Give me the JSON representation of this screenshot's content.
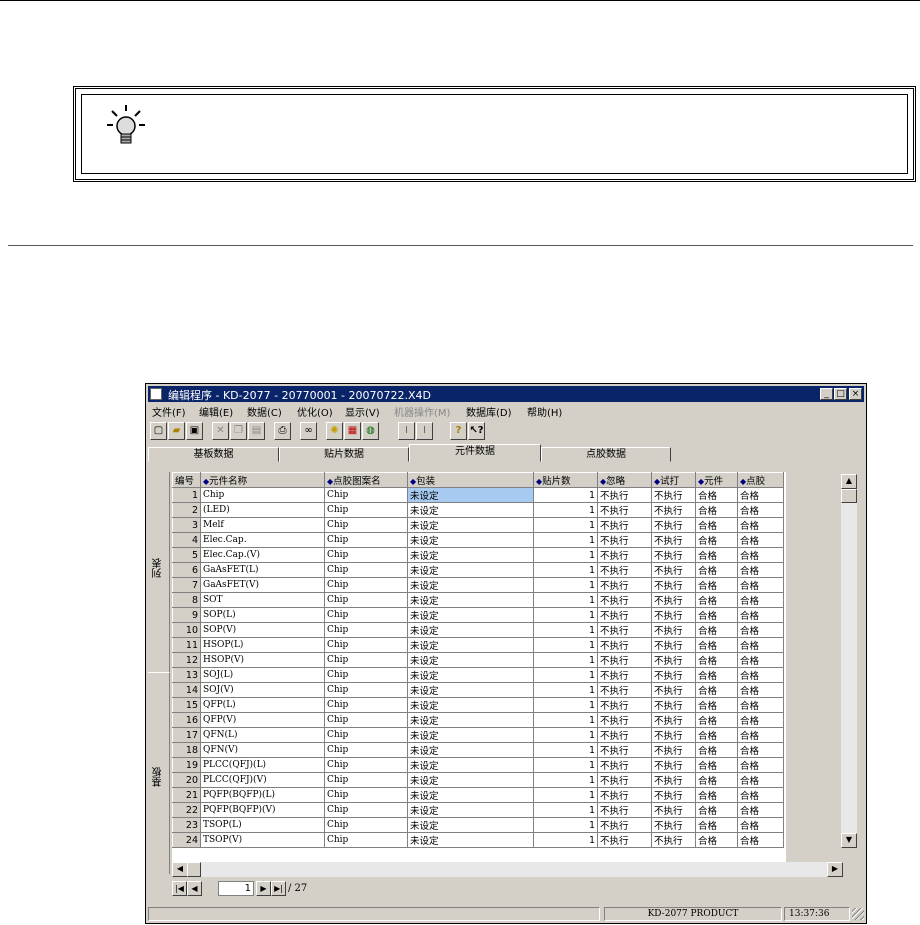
{
  "window": {
    "title": "编辑程序 - KD-2077 - 20770001 - 20070722.X4D"
  },
  "menu": [
    {
      "label": "文件(F)",
      "enabled": true
    },
    {
      "label": "编辑(E)",
      "enabled": true
    },
    {
      "label": "数据(C)",
      "enabled": true
    },
    {
      "label": "优化(O)",
      "enabled": true
    },
    {
      "label": "显示(V)",
      "enabled": true
    },
    {
      "label": "机器操作(M)",
      "enabled": false
    },
    {
      "label": "数据库(D)",
      "enabled": true
    },
    {
      "label": "帮助(H)",
      "enabled": true
    }
  ],
  "tabs": [
    "基板数据",
    "贴片数据",
    "元件数据",
    "点胶数据"
  ],
  "active_tab": 2,
  "side": {
    "top_label": "列表",
    "bottom_label": "基板"
  },
  "columns": [
    "编号",
    "元件名称",
    "点胶图案名",
    "包装",
    "贴片数",
    "忽略",
    "试打",
    "元件",
    "点胶"
  ],
  "rows": [
    {
      "no": "1",
      "name": "Chip",
      "pattern": "Chip",
      "pack": "未设定",
      "count": "1",
      "ignore": "不执行",
      "trial": "不执行",
      "part": "合格",
      "glue": "合格"
    },
    {
      "no": "2",
      "name": "(LED)",
      "pattern": "Chip",
      "pack": "未设定",
      "count": "1",
      "ignore": "不执行",
      "trial": "不执行",
      "part": "合格",
      "glue": "合格"
    },
    {
      "no": "3",
      "name": "Melf",
      "pattern": "Chip",
      "pack": "未设定",
      "count": "1",
      "ignore": "不执行",
      "trial": "不执行",
      "part": "合格",
      "glue": "合格"
    },
    {
      "no": "4",
      "name": "Elec.Cap.",
      "pattern": "Chip",
      "pack": "未设定",
      "count": "1",
      "ignore": "不执行",
      "trial": "不执行",
      "part": "合格",
      "glue": "合格"
    },
    {
      "no": "5",
      "name": "Elec.Cap.(V)",
      "pattern": "Chip",
      "pack": "未设定",
      "count": "1",
      "ignore": "不执行",
      "trial": "不执行",
      "part": "合格",
      "glue": "合格"
    },
    {
      "no": "6",
      "name": "GaAsFET(L)",
      "pattern": "Chip",
      "pack": "未设定",
      "count": "1",
      "ignore": "不执行",
      "trial": "不执行",
      "part": "合格",
      "glue": "合格"
    },
    {
      "no": "7",
      "name": "GaAsFET(V)",
      "pattern": "Chip",
      "pack": "未设定",
      "count": "1",
      "ignore": "不执行",
      "trial": "不执行",
      "part": "合格",
      "glue": "合格"
    },
    {
      "no": "8",
      "name": "SOT",
      "pattern": "Chip",
      "pack": "未设定",
      "count": "1",
      "ignore": "不执行",
      "trial": "不执行",
      "part": "合格",
      "glue": "合格"
    },
    {
      "no": "9",
      "name": "SOP(L)",
      "pattern": "Chip",
      "pack": "未设定",
      "count": "1",
      "ignore": "不执行",
      "trial": "不执行",
      "part": "合格",
      "glue": "合格"
    },
    {
      "no": "10",
      "name": "SOP(V)",
      "pattern": "Chip",
      "pack": "未设定",
      "count": "1",
      "ignore": "不执行",
      "trial": "不执行",
      "part": "合格",
      "glue": "合格"
    },
    {
      "no": "11",
      "name": "HSOP(L)",
      "pattern": "Chip",
      "pack": "未设定",
      "count": "1",
      "ignore": "不执行",
      "trial": "不执行",
      "part": "合格",
      "glue": "合格"
    },
    {
      "no": "12",
      "name": "HSOP(V)",
      "pattern": "Chip",
      "pack": "未设定",
      "count": "1",
      "ignore": "不执行",
      "trial": "不执行",
      "part": "合格",
      "glue": "合格"
    },
    {
      "no": "13",
      "name": "SOJ(L)",
      "pattern": "Chip",
      "pack": "未设定",
      "count": "1",
      "ignore": "不执行",
      "trial": "不执行",
      "part": "合格",
      "glue": "合格"
    },
    {
      "no": "14",
      "name": "SOJ(V)",
      "pattern": "Chip",
      "pack": "未设定",
      "count": "1",
      "ignore": "不执行",
      "trial": "不执行",
      "part": "合格",
      "glue": "合格"
    },
    {
      "no": "15",
      "name": "QFP(L)",
      "pattern": "Chip",
      "pack": "未设定",
      "count": "1",
      "ignore": "不执行",
      "trial": "不执行",
      "part": "合格",
      "glue": "合格"
    },
    {
      "no": "16",
      "name": "QFP(V)",
      "pattern": "Chip",
      "pack": "未设定",
      "count": "1",
      "ignore": "不执行",
      "trial": "不执行",
      "part": "合格",
      "glue": "合格"
    },
    {
      "no": "17",
      "name": "QFN(L)",
      "pattern": "Chip",
      "pack": "未设定",
      "count": "1",
      "ignore": "不执行",
      "trial": "不执行",
      "part": "合格",
      "glue": "合格"
    },
    {
      "no": "18",
      "name": "QFN(V)",
      "pattern": "Chip",
      "pack": "未设定",
      "count": "1",
      "ignore": "不执行",
      "trial": "不执行",
      "part": "合格",
      "glue": "合格"
    },
    {
      "no": "19",
      "name": "PLCC(QFJ)(L)",
      "pattern": "Chip",
      "pack": "未设定",
      "count": "1",
      "ignore": "不执行",
      "trial": "不执行",
      "part": "合格",
      "glue": "合格"
    },
    {
      "no": "20",
      "name": "PLCC(QFJ)(V)",
      "pattern": "Chip",
      "pack": "未设定",
      "count": "1",
      "ignore": "不执行",
      "trial": "不执行",
      "part": "合格",
      "glue": "合格"
    },
    {
      "no": "21",
      "name": "PQFP(BQFP)(L)",
      "pattern": "Chip",
      "pack": "未设定",
      "count": "1",
      "ignore": "不执行",
      "trial": "不执行",
      "part": "合格",
      "glue": "合格"
    },
    {
      "no": "22",
      "name": "PQFP(BQFP)(V)",
      "pattern": "Chip",
      "pack": "未设定",
      "count": "1",
      "ignore": "不执行",
      "trial": "不执行",
      "part": "合格",
      "glue": "合格"
    },
    {
      "no": "23",
      "name": "TSOP(L)",
      "pattern": "Chip",
      "pack": "未设定",
      "count": "1",
      "ignore": "不执行",
      "trial": "不执行",
      "part": "合格",
      "glue": "合格"
    },
    {
      "no": "24",
      "name": "TSOP(V)",
      "pattern": "Chip",
      "pack": "未设定",
      "count": "1",
      "ignore": "不执行",
      "trial": "不执行",
      "part": "合格",
      "glue": "合格"
    }
  ],
  "pager": {
    "current": "1",
    "total": "/ 27"
  },
  "status": {
    "panel1": "",
    "product": "KD-2077 PRODUCT",
    "time": "13:37:36"
  },
  "icons": {
    "toolbar": [
      "new-file-icon",
      "open-folder-icon",
      "save-icon",
      "cut-icon",
      "copy-icon",
      "paste-icon",
      "print-icon",
      "find-icon",
      "idea-icon",
      "component-icon",
      "optimize-icon",
      "align-left-icon",
      "align-right-icon",
      "help-icon",
      "context-help-icon"
    ],
    "note": "lightbulb-icon"
  },
  "colors": {
    "titlebar": "#0a246a",
    "window_bg": "#d4d0c8",
    "selection": "#a6caf0"
  }
}
